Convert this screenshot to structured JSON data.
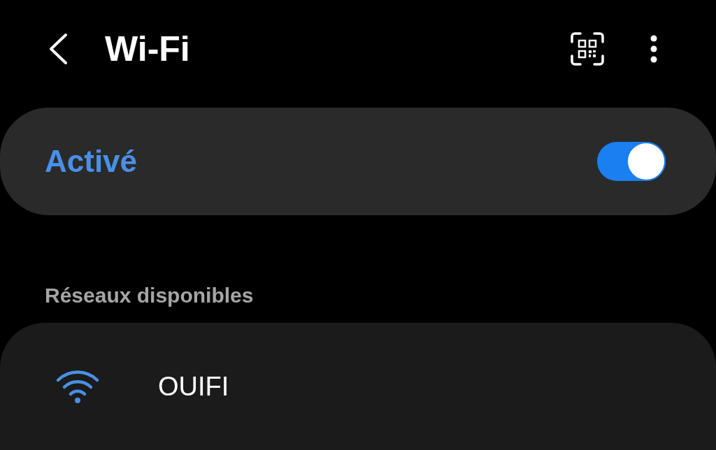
{
  "header": {
    "title": "Wi-Fi"
  },
  "wifi_toggle": {
    "label": "Activé",
    "on": true
  },
  "available_networks": {
    "label": "Réseaux disponibles",
    "items": [
      {
        "name": "OUIFI"
      }
    ]
  }
}
